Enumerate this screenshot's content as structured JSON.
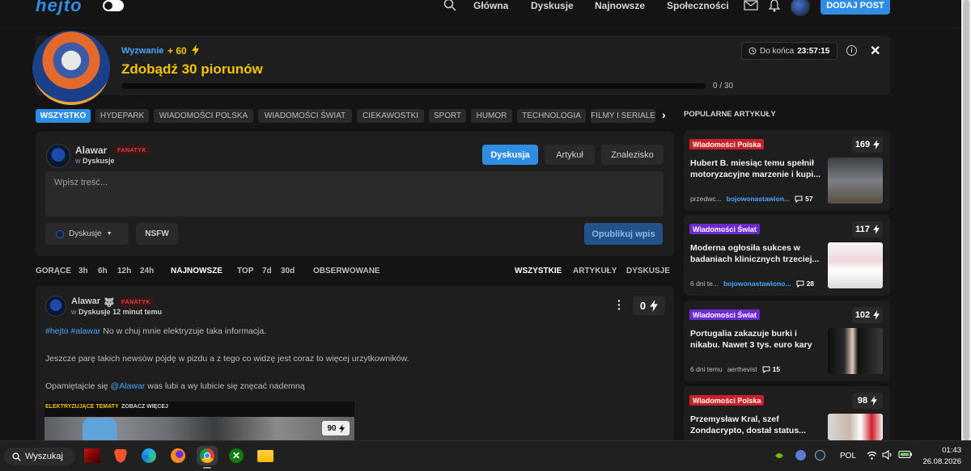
{
  "nav": {
    "logo": "hejto",
    "links": [
      "Główna",
      "Dyskusje",
      "Najnowsze",
      "Społeczności"
    ],
    "add_post": "DODAJ POST"
  },
  "challenge": {
    "label": "Wyzwanie",
    "points": "+ 60",
    "title": "Zdobądź 30 piorunów",
    "progress_text": "0 / 30",
    "progress_fraction": 0,
    "timer_label": "Do końca",
    "timer_value": "23:57:15",
    "info": "i"
  },
  "categories": [
    "WSZYSTKO",
    "HYDEPARK",
    "WIADOMOŚCI POLSKA",
    "WIADOMOŚCI ŚWIAT",
    "CIEKAWOSTKI",
    "SPORT",
    "HUMOR",
    "TECHNOLOGIA",
    "FILMY I SERIALE"
  ],
  "form": {
    "username": "Alawar",
    "rank": "FANATYK",
    "in_label": "w",
    "community": "Dyskusje",
    "types": [
      "Dyskusja",
      "Artykuł",
      "Znalezisko"
    ],
    "placeholder": "Wpisz treść...",
    "select_value": "Dyskusje",
    "nsfw": "NSFW",
    "publish": "Opublikuj wpis"
  },
  "sort_left": [
    "GORĄCE",
    "3h",
    "6h",
    "12h",
    "24h",
    "NAJNOWSZE",
    "TOP",
    "7d",
    "30d",
    "OBSERWOWANE"
  ],
  "sort_right": [
    "WSZYSTKIE",
    "ARTYKUŁY",
    "DYSKUSJE"
  ],
  "post": {
    "username": "Alawar",
    "rank": "FANATYK",
    "in_label": "w",
    "community": "Dyskusje",
    "time": "12 minut temu",
    "votes": "0",
    "tag1": "#hejto",
    "tag2": "#alawar",
    "line1_rest": "No w chuj mnie elektryzuje taka informacja.",
    "line2": "Jeszcze parę takich newsów pójdę w pizdu a z tego co widzę jest coraz to więcej urzytkowników.",
    "line3_a": "Opamiętajcie się",
    "line3_mention": "@Alawar",
    "line3_b": "was lubi a wy lubicie się znęcać nademną",
    "embed_label": "ELEKTRYZUJĄCE TEMATY",
    "embed_more": "ZOBACZ WIĘCEJ",
    "embed_votes": "90"
  },
  "sidebar": {
    "title": "POPULARNE ARTYKUŁY",
    "cards": [
      {
        "badge": "Wiadomości Polska",
        "badge_color": "#c8202a",
        "votes": "169",
        "title": "Hubert B. miesiąc temu spełnił motoryzacyjne marzenie i kupi...",
        "time": "przedwc...",
        "author": "bojowonastawion...",
        "comments": "57"
      },
      {
        "badge": "Wiadomości Świat",
        "badge_color": "#6a2ad0",
        "votes": "117",
        "title": "Moderna ogłosiła sukces w badaniach klinicznych trzeciej...",
        "time": "6 dni te...",
        "author": "bojowonastawiono...",
        "comments": "28"
      },
      {
        "badge": "Wiadomości Świat",
        "badge_color": "#6a2ad0",
        "votes": "102",
        "title": "Portugalia zakazuje burki i nikabu. Nawet 3 tys. euro kary",
        "time": "6 dni temu",
        "author": "aerthevist",
        "comments": "15"
      },
      {
        "badge": "Wiadomości Polska",
        "badge_color": "#c8202a",
        "votes": "98",
        "title": "Przemysław Kral, szef Zondacrypto, dostał status...",
        "time": "",
        "author": "",
        "comments": ""
      }
    ]
  },
  "taskbar": {
    "search": "Wyszukaj",
    "lang": "POL",
    "time": "01:43",
    "date": "26.08.2026"
  },
  "colors": {
    "accent": "#2f8de4",
    "challenge": "#f5c400",
    "bg": "#141414",
    "card": "#1e1e1e"
  }
}
